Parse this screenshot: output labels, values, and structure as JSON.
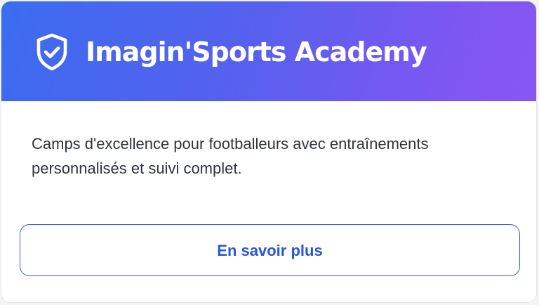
{
  "header": {
    "title": "Imagin'Sports Academy",
    "icon": "shield-check-icon",
    "gradient_colors": [
      "#3b6cf0",
      "#8a56f3"
    ]
  },
  "body": {
    "description": "Camps d'excellence pour footballeurs avec entraînements personnalisés et suivi complet."
  },
  "cta": {
    "label": "En savoir plus",
    "color": "#2856db"
  }
}
